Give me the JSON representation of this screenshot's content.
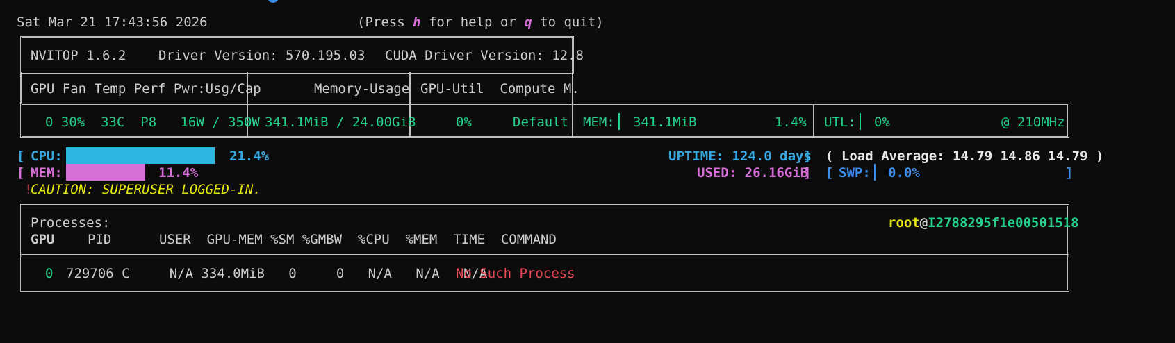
{
  "header": {
    "datetime": "Sat Mar 21 17:43:56 2026",
    "help_prefix": "(Press ",
    "help_key": "h",
    "help_mid": " for help or ",
    "quit_key": "q",
    "help_suffix": " to quit)"
  },
  "info": {
    "app": "NVITOP 1.6.2",
    "driver": "Driver Version: 570.195.03",
    "cuda": "CUDA Driver Version: 12.8"
  },
  "gpu_table": {
    "headers": {
      "gpu_fan_temp": "GPU Fan Temp Perf Pwr:Usg/Cap",
      "memory_usage": "Memory-Usage",
      "gpu_util_compute": "GPU-Util  Compute M."
    },
    "row": {
      "gpu_stats": "0 30%  33C  P8   16W / 350W",
      "memory": "341.1MiB / 24.00GiB",
      "util": "0%",
      "compute_mode": "Default",
      "mem_label": "MEM:",
      "mem_value": "341.1MiB",
      "mem_percent": "1.4%",
      "utl_label": "UTL:",
      "utl_value": "0%",
      "clock": "@ 210MHz"
    }
  },
  "host": {
    "cpu_label": "CPU:",
    "cpu_percent": "21.4%",
    "cpu_fraction": 0.214,
    "mem_label": "MEM:",
    "mem_percent": "11.4%",
    "mem_fraction": 0.114,
    "uptime": "UPTIME: 124.0 days",
    "load_average": "( Load Average: 14.79 14.86 14.79 )",
    "used": "USED: 26.16GiB",
    "swp_label": "SWP:",
    "swp_percent": "0.0%",
    "caution_mark": "!",
    "caution_text": "CAUTION: SUPERUSER LOGGED-IN."
  },
  "processes": {
    "title": "Processes:",
    "user_host_user": "root",
    "user_host_at": "@",
    "user_host_host": "I2788295f1e00501518",
    "columns": {
      "gpu": "GPU",
      "rest": "PID      USER  GPU-MEM %SM %GMBW  %CPU  %MEM  TIME  COMMAND"
    },
    "rows": [
      {
        "gpu": "0",
        "fields": "729706 C     N/A 334.0MiB   0     0   N/A   N/A   N/A",
        "command": "No Such Process"
      }
    ]
  },
  "colors": {
    "background": "#0c0c0c",
    "green": "#16c60c",
    "cyan_bar": "#2bb5e0",
    "magenta_bar": "#d670d6",
    "red": "#e74856",
    "yellow": "#e5e510"
  }
}
